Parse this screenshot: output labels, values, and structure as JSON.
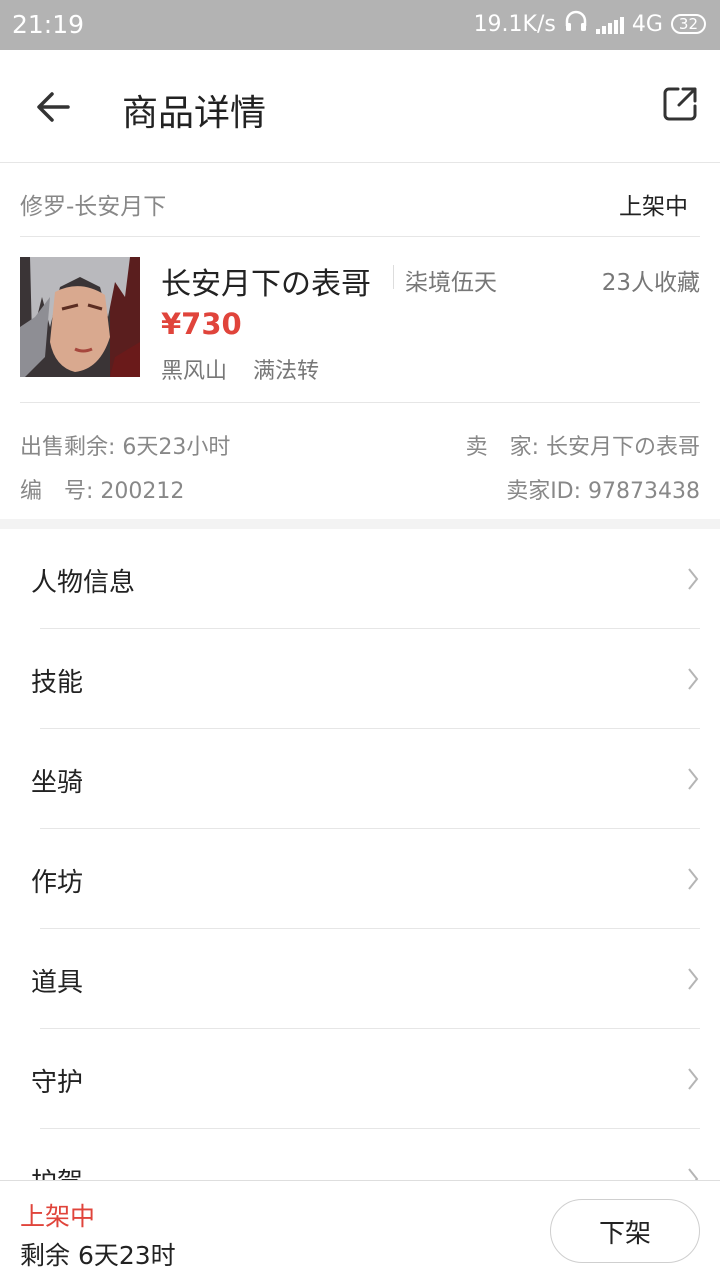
{
  "status_bar": {
    "time": "21:19",
    "network_speed": "19.1K/s",
    "network_type": "4G",
    "battery": "32"
  },
  "header": {
    "title": "商品详情",
    "back_icon": "arrow-left-icon",
    "share_icon": "share-external-icon"
  },
  "category": {
    "name": "修罗-长安月下",
    "status": "上架中"
  },
  "product": {
    "name": "长安月下の表哥",
    "server": "柒境伍天",
    "favorites": "23人收藏",
    "price": "¥730",
    "tags": [
      "黑风山",
      "满法转"
    ]
  },
  "meta": {
    "remain_label": "出售剩余: 6天23小时",
    "seller_label": "卖　家: 长安月下の表哥",
    "code_label": "编　号: 200212",
    "seller_id_label": "卖家ID: 97873438"
  },
  "menu": {
    "items": [
      "人物信息",
      "技能",
      "坐骑",
      "作坊",
      "道具",
      "守护",
      "护驾"
    ]
  },
  "footer": {
    "status": "上架中",
    "remain": "剩余 6天23时",
    "delist_button": "下架"
  },
  "colors": {
    "accent_red": "#e0443b",
    "status_bar": "#b3b3b3"
  }
}
